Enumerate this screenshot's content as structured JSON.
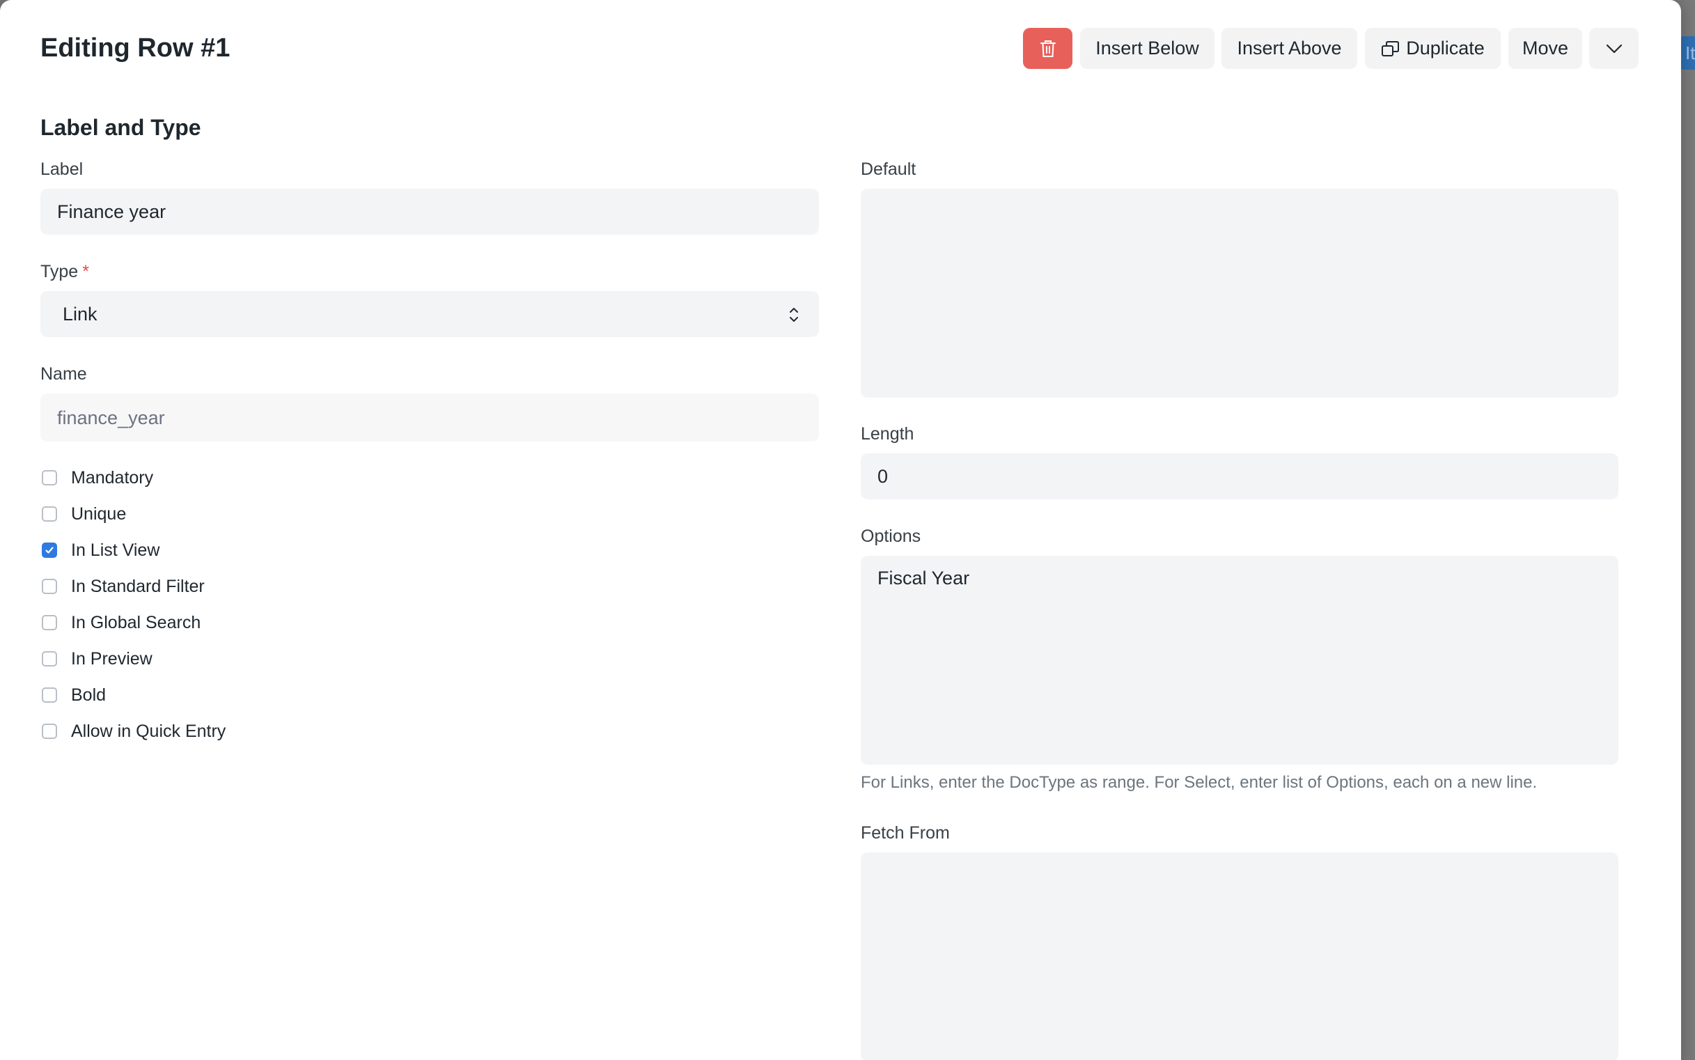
{
  "background": {
    "button_text": "Ite"
  },
  "header": {
    "title": "Editing Row #1",
    "buttons": {
      "insert_below": "Insert Below",
      "insert_above": "Insert Above",
      "duplicate": "Duplicate",
      "move": "Move"
    }
  },
  "section": {
    "title": "Label and Type"
  },
  "fields": {
    "label": {
      "label": "Label",
      "value": "Finance year"
    },
    "type": {
      "label": "Type",
      "required_mark": "*",
      "value": "Link"
    },
    "name": {
      "label": "Name",
      "value": "finance_year"
    },
    "default": {
      "label": "Default",
      "value": ""
    },
    "length": {
      "label": "Length",
      "value": "0"
    },
    "options": {
      "label": "Options",
      "value": "Fiscal Year",
      "help": "For Links, enter the DocType as range. For Select, enter list of Options, each on a new line."
    },
    "fetch_from": {
      "label": "Fetch From",
      "value": ""
    }
  },
  "checkboxes": [
    {
      "label": "Mandatory",
      "checked": false
    },
    {
      "label": "Unique",
      "checked": false
    },
    {
      "label": "In List View",
      "checked": true
    },
    {
      "label": "In Standard Filter",
      "checked": false
    },
    {
      "label": "In Global Search",
      "checked": false
    },
    {
      "label": "In Preview",
      "checked": false
    },
    {
      "label": "Bold",
      "checked": false
    },
    {
      "label": "Allow in Quick Entry",
      "checked": false
    }
  ],
  "colors": {
    "delete_button": "#e8605a",
    "checkbox_checked": "#2e7ae0",
    "required": "#e24c4c",
    "field_bg": "#f3f4f6"
  },
  "icons": {
    "delete": "trash-icon",
    "duplicate": "duplicate-icon",
    "more": "chevron-down-icon",
    "select": "select-arrows-icon",
    "check": "check-icon"
  }
}
